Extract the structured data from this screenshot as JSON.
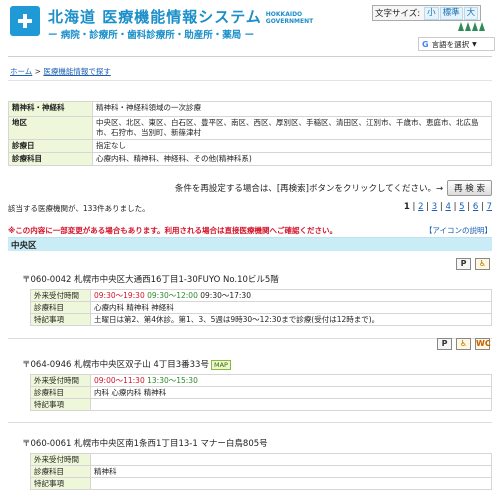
{
  "header": {
    "title": "北海道 医療機能情報システム",
    "title_en_1": "HOKKAIDO",
    "title_en_2": "GOVERNMENT",
    "subtitle": "ー 病院・診療所・歯科診療所・助産所・薬局 ー",
    "font_size_label": "文字サイズ:",
    "font_sizes": [
      "小",
      "標準",
      "大"
    ],
    "translate_g": "G",
    "translate_label": "言語を選択",
    "translate_arrow": "▼"
  },
  "breadcrumb": {
    "home": "ホーム",
    "sep": " > ",
    "current": "医療機能情報で探す"
  },
  "criteria": [
    {
      "key": "精神科・神経科",
      "value": "精神科・神経科領域の一次診療"
    },
    {
      "key": "地区",
      "value": "中央区、北区、東区、白石区、豊平区、南区、西区、厚別区、手稲区、清田区、江別市、千歳市、恵庭市、北広島市、石狩市、当別町、新篠津村"
    },
    {
      "key": "診療日",
      "value": "指定なし"
    },
    {
      "key": "診療科目",
      "value": "心療内科、精神科、神経科、その他(精神科系)"
    }
  ],
  "research": {
    "text": "条件を再設定する場合は、[再検索]ボタンをクリックしてください。→",
    "button": "再 検 索"
  },
  "count_text": "該当する医療機関が、133件ありました。",
  "pager": {
    "current": "1",
    "pages": [
      "2",
      "3",
      "4",
      "5",
      "6",
      "7"
    ]
  },
  "notice": "※この内容に一部変更がある場合もあります。利用される場合は直接医療機関へご確認ください。",
  "icon_help": "【アイコンの説明】",
  "section_title": "中央区",
  "labels": {
    "hours": "外来受付時間",
    "subjects": "診療科目",
    "notes": "特記事項"
  },
  "icon_labels": {
    "parking": "P",
    "wheelchair": "♿",
    "wc": "WC"
  },
  "entries": [
    {
      "address": "〒060-0042 札幌市中央区大通西16丁目1-30FUYO No.10ビル5階",
      "hours": [
        "09:30～19:30",
        "09:30～12:00",
        "09:30～17:30"
      ],
      "subjects": "心療内科 精神科 神経科",
      "notes": "土曜日は第2、第4休診。第1、3、5週は9時30～12:30まで診療(受付は12時まで)。"
    },
    {
      "address": "〒064-0946 札幌市中央区双子山 4丁目3番33号",
      "map": "MAP",
      "hours": [
        "09:00～11:30",
        "13:30～15:30"
      ],
      "subjects": "内科 心療内科 精神科",
      "notes": ""
    },
    {
      "address": "〒060-0061 札幌市中央区南1条西1丁目13-1 マナー白鳥805号",
      "hours": [],
      "subjects": "精神科",
      "notes": ""
    }
  ],
  "colors": {
    "brand": "#1a8fc9",
    "section": "#c9ecf7",
    "key_bg": "#eef7d9",
    "alert": "#d4142a"
  }
}
